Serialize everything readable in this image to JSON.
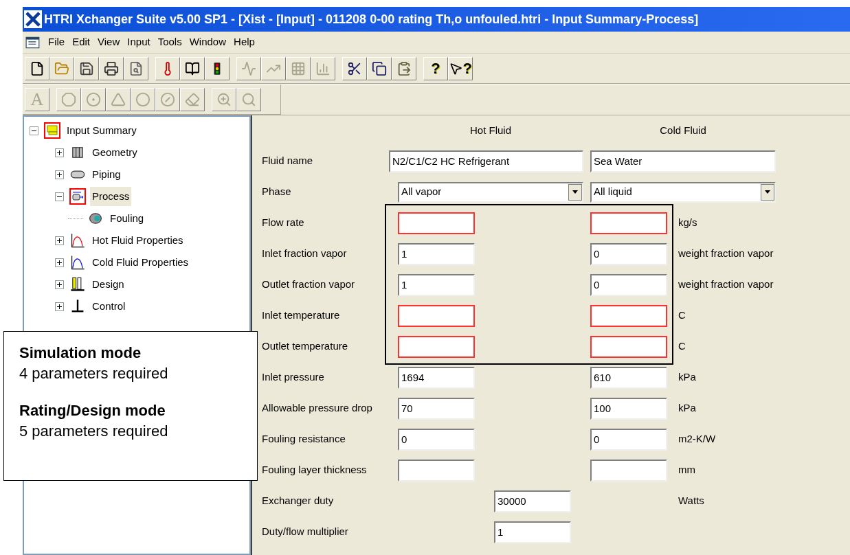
{
  "window": {
    "title": "HTRI Xchanger Suite v5.00 SP1 - [Xist - [Input] - 011208 0-00 rating Th,o unfouled.htri - Input Summary-Process]"
  },
  "menu": [
    "File",
    "Edit",
    "View",
    "Input",
    "Tools",
    "Window",
    "Help"
  ],
  "toolbar_1": [
    [
      {
        "disabled": false
      },
      {
        "disabled": false
      },
      {
        "disabled": false
      },
      {
        "disabled": false
      },
      {
        "disabled": false
      }
    ],
    [
      {
        "disabled": false
      },
      {
        "disabled": false
      },
      {
        "disabled": false
      }
    ],
    [
      {
        "disabled": true
      },
      {
        "disabled": true
      },
      {
        "disabled": true
      },
      {
        "disabled": true
      }
    ],
    [
      {
        "disabled": false
      },
      {
        "disabled": false
      },
      {
        "disabled": false
      }
    ],
    [
      {
        "disabled": false,
        "label": "?"
      },
      {
        "disabled": false,
        "label": "?"
      }
    ]
  ],
  "toolbar_2": [
    [
      {
        "disabled": true,
        "label": "A"
      }
    ],
    [
      {
        "disabled": true
      },
      {
        "disabled": true
      },
      {
        "disabled": true
      },
      {
        "disabled": true
      },
      {
        "disabled": true
      },
      {
        "disabled": true
      }
    ],
    [
      {
        "disabled": true
      },
      {
        "disabled": true
      }
    ]
  ],
  "tree": [
    {
      "label": "Input Summary",
      "expanded": true,
      "selected": false,
      "flagged": true,
      "children": [
        {
          "label": "Geometry",
          "expanded": false,
          "selected": false,
          "flagged": false
        },
        {
          "label": "Piping",
          "expanded": false,
          "selected": false,
          "flagged": false
        },
        {
          "label": "Process",
          "expanded": true,
          "selected": true,
          "flagged": true,
          "children": [
            {
              "label": "Fouling",
              "selected": false,
              "flagged": false
            }
          ]
        },
        {
          "label": "Hot Fluid Properties",
          "expanded": false,
          "selected": false,
          "flagged": false
        },
        {
          "label": "Cold Fluid Properties",
          "expanded": false,
          "selected": false,
          "flagged": false
        },
        {
          "label": "Design",
          "expanded": false,
          "selected": false,
          "flagged": false
        },
        {
          "label": "Control",
          "expanded": false,
          "selected": false,
          "flagged": false
        }
      ]
    }
  ],
  "form": {
    "columns": [
      "Hot Fluid",
      "Cold Fluid"
    ],
    "rows": [
      {
        "kind": "text",
        "label": "Fluid name",
        "hot": "N2/C1/C2 HC Refrigerant",
        "cold": "Sea Water"
      },
      {
        "kind": "select",
        "label": "Phase",
        "hot": "All vapor",
        "cold": "All liquid"
      },
      {
        "kind": "pair",
        "label": "Flow rate",
        "hot": "",
        "cold": "",
        "unit": "kg/s",
        "required": true
      },
      {
        "kind": "pair",
        "label": "Inlet fraction vapor",
        "hot": "1",
        "cold": "0",
        "unit": "weight fraction vapor",
        "required": false
      },
      {
        "kind": "pair",
        "label": "Outlet fraction vapor",
        "hot": "1",
        "cold": "0",
        "unit": "weight fraction vapor",
        "required": false
      },
      {
        "kind": "pair",
        "label": "Inlet temperature",
        "hot": "",
        "cold": "",
        "unit": "C",
        "required": true
      },
      {
        "kind": "pair",
        "label": "Outlet temperature",
        "hot": "",
        "cold": "",
        "unit": "C",
        "required": true
      },
      {
        "kind": "pair",
        "label": "Inlet pressure",
        "hot": "1694",
        "cold": "610",
        "unit": "kPa",
        "required": false
      },
      {
        "kind": "pair",
        "label": "Allowable pressure drop",
        "hot": "70",
        "cold": "100",
        "unit": "kPa",
        "required": false
      },
      {
        "kind": "pair",
        "label": "Fouling resistance",
        "hot": "0",
        "cold": "0",
        "unit": "m2-K/W",
        "required": false
      },
      {
        "kind": "pair",
        "label": "Fouling layer thickness",
        "hot": "",
        "cold": "",
        "unit": "mm",
        "required": false
      },
      {
        "kind": "single",
        "label": "Exchanger duty",
        "value": "30000",
        "unit": "Watts"
      },
      {
        "kind": "single",
        "label": "Duty/flow multiplier",
        "value": "1"
      }
    ]
  },
  "note": {
    "lines": [
      {
        "text": "Simulation mode",
        "bold": true
      },
      {
        "text": "4 parameters required",
        "bold": false
      },
      {
        "text": "Rating/Design mode",
        "bold": true
      },
      {
        "text": "5 parameters required",
        "bold": false
      }
    ]
  }
}
